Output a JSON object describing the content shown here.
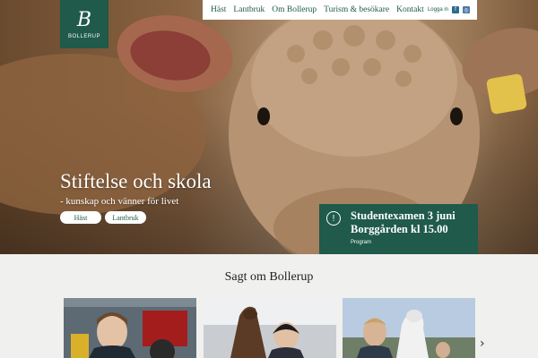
{
  "logo": {
    "mark": "B",
    "name": "BOLLERUP"
  },
  "nav": {
    "items": [
      "Häst",
      "Lantbruk",
      "Om Bollerup",
      "Turism & besökare",
      "Kontakt"
    ],
    "login": "Logga in",
    "facebook_icon": "f",
    "instagram_icon": "◎"
  },
  "hero": {
    "title": "Stiftelse och skola",
    "subtitle": "- kunskap och vänner för livet",
    "tags": [
      "Häst",
      "Lantbruk"
    ]
  },
  "event": {
    "badge": "!",
    "title": "Studentexamen 3 juni Borggården kl 15.00",
    "link": "Program"
  },
  "section": {
    "title": "Sagt om Bollerup",
    "next": "›"
  },
  "colors": {
    "brand_green": "#1f5a4a",
    "nav_bg": "#ffffff"
  }
}
